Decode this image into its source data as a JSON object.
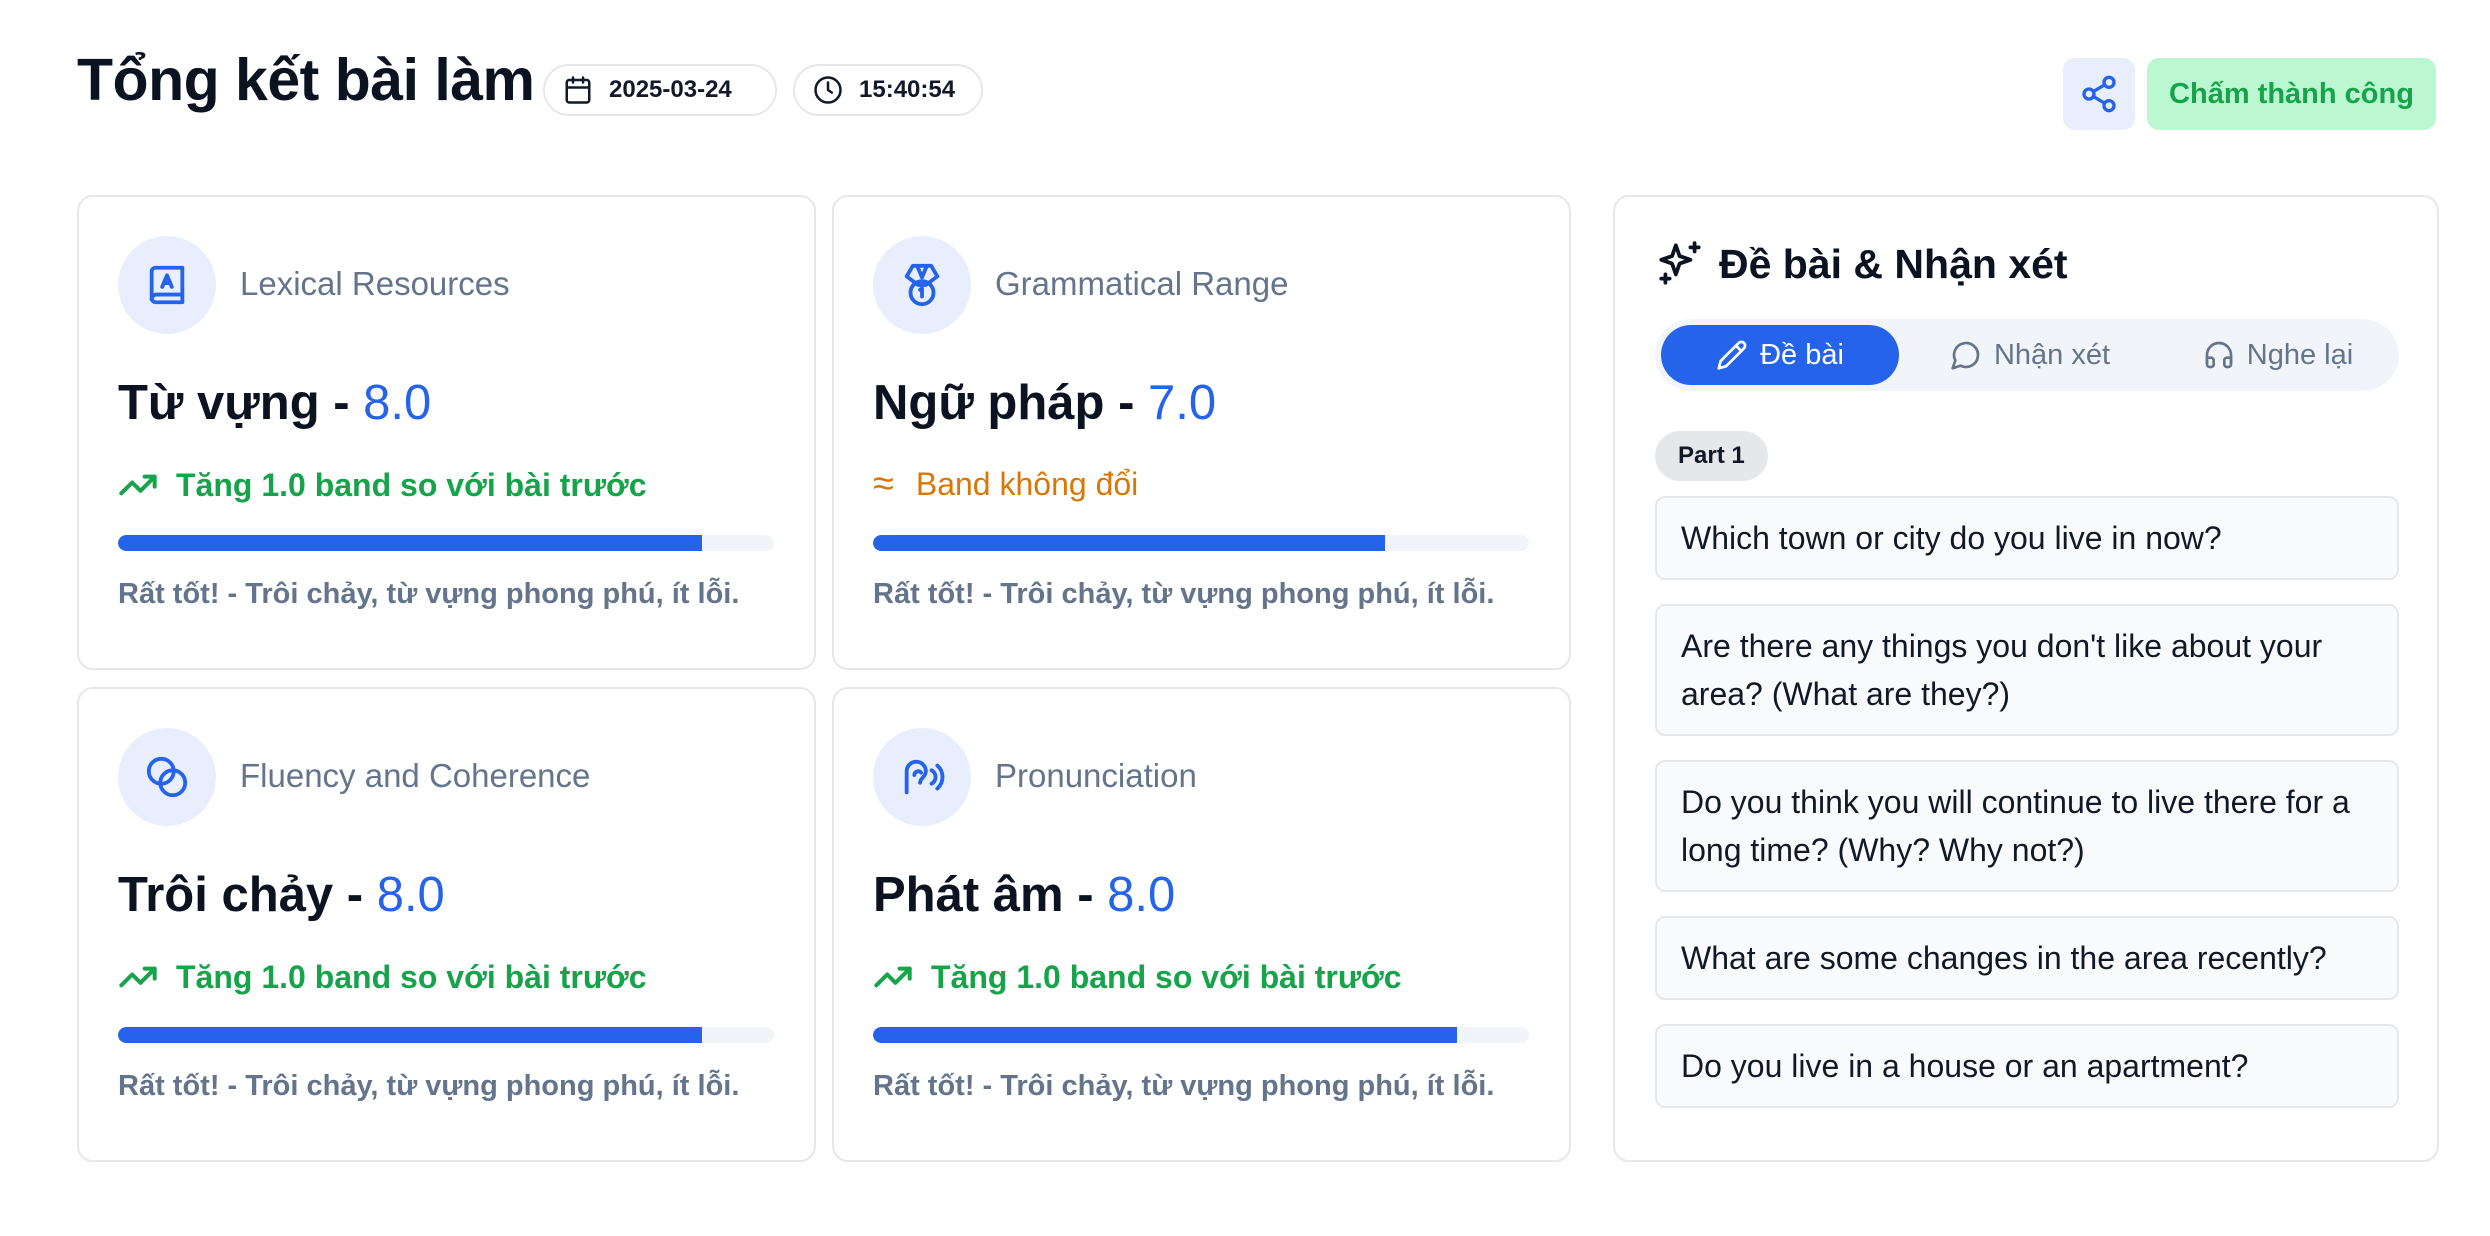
{
  "header": {
    "title": "Tổng kết bài làm",
    "date": "2025-03-24",
    "time": "15:40:54",
    "status_label": "Chấm thành công"
  },
  "cards": [
    {
      "category": "Lexical Resources",
      "label": "Từ vựng - ",
      "score": "8.0",
      "trend": "Tăng 1.0 band so với bài trước",
      "trend_type": "up",
      "progress": 0.89,
      "note": "Rất tốt! - Trôi chảy, từ vựng phong phú, ít lỗi.",
      "icon": "book-icon"
    },
    {
      "category": "Grammatical Range",
      "label": "Ngữ pháp - ",
      "score": "7.0",
      "trend": "Band không đổi",
      "trend_type": "flat",
      "trend_symbol": "≈",
      "progress": 0.78,
      "note": "Rất tốt! - Trôi chảy, từ vựng phong phú, ít lỗi.",
      "icon": "medal-icon"
    },
    {
      "category": "Fluency and Coherence",
      "label": "Trôi chảy - ",
      "score": "8.0",
      "trend": "Tăng 1.0 band so với bài trước",
      "trend_type": "up",
      "progress": 0.89,
      "note": "Rất tốt! - Trôi chảy, từ vựng phong phú, ít lỗi.",
      "icon": "circles-icon"
    },
    {
      "category": "Pronunciation",
      "label": "Phát âm - ",
      "score": "8.0",
      "trend": "Tăng 1.0 band so với bài trước",
      "trend_type": "up",
      "progress": 0.89,
      "note": "Rất tốt! - Trôi chảy, từ vựng phong phú, ít lỗi.",
      "icon": "ear-icon"
    }
  ],
  "panel": {
    "title": "Đề bài & Nhận xét",
    "tabs": [
      {
        "label": "Đề bài",
        "active": true
      },
      {
        "label": "Nhận xét",
        "active": false
      },
      {
        "label": "Nghe lại",
        "active": false
      }
    ],
    "part_label": "Part 1",
    "questions": [
      "Which town or city do you live in now?",
      "Are there any things you don't like about your area? (What are they?)",
      "Do you think you will continue to live there for a long time? (Why? Why not?)",
      "What are some changes in the area recently?",
      "Do you live in a house or an apartment?"
    ]
  },
  "colors": {
    "accent": "#2563eb",
    "success": "#16a34a",
    "warning": "#d97706",
    "muted": "#64748b"
  }
}
